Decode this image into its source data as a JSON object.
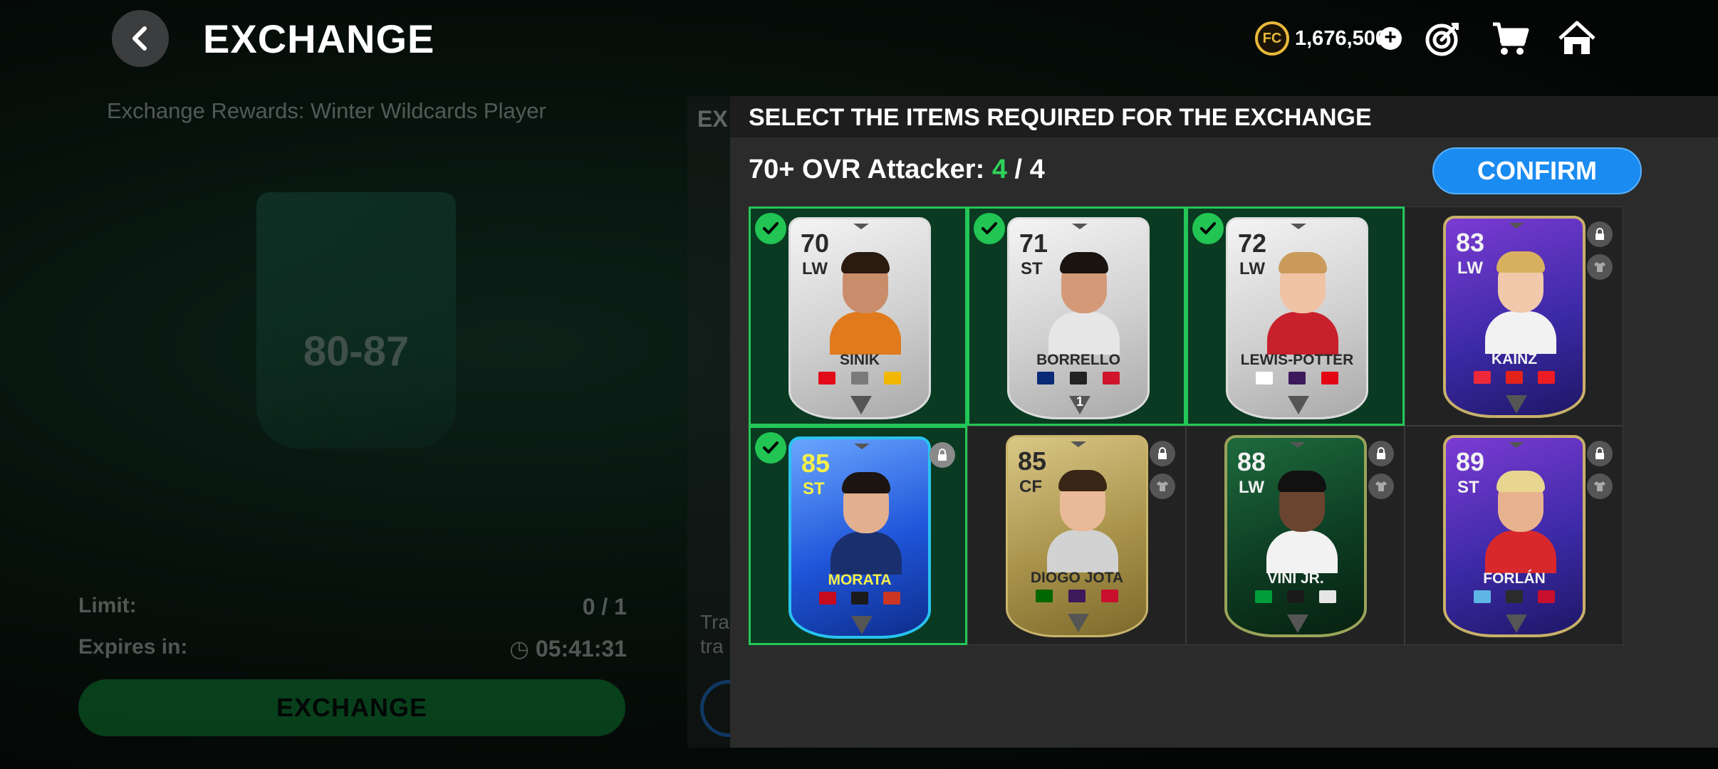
{
  "header": {
    "title": "EXCHANGE",
    "coins": "1,676,500"
  },
  "background": {
    "rewards_label": "Exchange Rewards:  Winter Wildcards Player",
    "card_range": "80-87",
    "limit_label": "Limit:",
    "limit_value": "0 / 1",
    "expires_label": "Expires in:",
    "expires_value": "05:41:31",
    "exchange_button": "EXCHANGE",
    "right_title": "EX",
    "right_text": "Tra\ntra"
  },
  "modal": {
    "title": "SELECT THE ITEMS REQUIRED FOR THE EXCHANGE",
    "requirement_label": "70+ OVR Attacker:",
    "requirement_done": "4",
    "requirement_total": "/ 4",
    "confirm_label": "CONFIRM"
  },
  "players": [
    {
      "name": "SINIK",
      "rating": "70",
      "position": "LW",
      "selected": true,
      "locked": false,
      "style": "silver"
    },
    {
      "name": "BORRELLO",
      "rating": "71",
      "position": "ST",
      "selected": true,
      "locked": false,
      "style": "silver",
      "chem": "1"
    },
    {
      "name": "LEWIS-POTTER",
      "rating": "72",
      "position": "LW",
      "selected": true,
      "locked": false,
      "style": "silver"
    },
    {
      "name": "KAINZ",
      "rating": "83",
      "position": "LW",
      "selected": false,
      "locked": true,
      "style": "purple"
    },
    {
      "name": "MORATA",
      "rating": "85",
      "position": "ST",
      "selected": true,
      "locked": true,
      "style": "blue"
    },
    {
      "name": "DIOGO JOTA",
      "rating": "85",
      "position": "CF",
      "selected": false,
      "locked": true,
      "style": "gold"
    },
    {
      "name": "VINI JR.",
      "rating": "88",
      "position": "LW",
      "selected": false,
      "locked": true,
      "style": "green"
    },
    {
      "name": "FORLÁN",
      "rating": "89",
      "position": "ST",
      "selected": false,
      "locked": true,
      "style": "purple"
    }
  ],
  "colors": {
    "accent_green": "#23c657",
    "confirm_blue": "#1a8bf0",
    "coin_gold": "#e8b83a"
  },
  "icons": [
    "back-arrow-icon",
    "coins-icon",
    "plus-icon",
    "objectives-target-icon",
    "store-cart-icon",
    "home-icon",
    "checkmark-icon",
    "lock-icon",
    "shirt-icon",
    "clock-icon"
  ]
}
